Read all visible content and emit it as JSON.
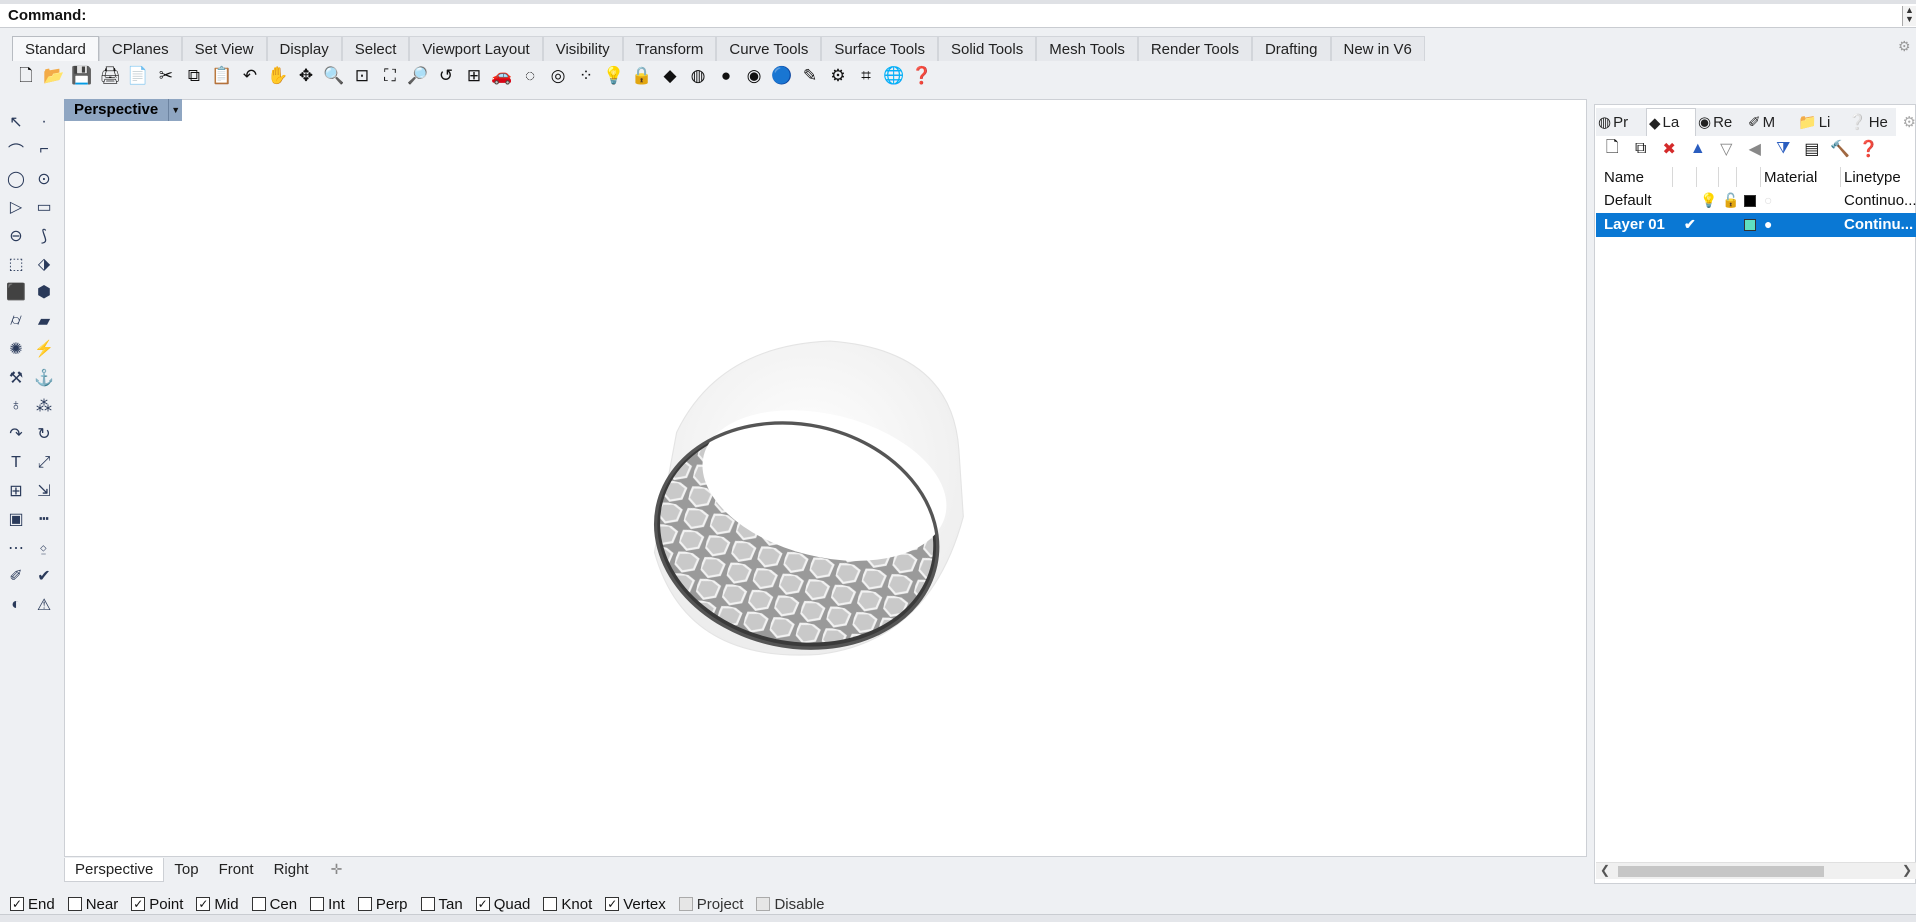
{
  "command": {
    "label": "Command:",
    "value": ""
  },
  "tabs": [
    {
      "label": "Standard",
      "active": true
    },
    {
      "label": "CPlanes"
    },
    {
      "label": "Set View"
    },
    {
      "label": "Display"
    },
    {
      "label": "Select"
    },
    {
      "label": "Viewport Layout"
    },
    {
      "label": "Visibility"
    },
    {
      "label": "Transform"
    },
    {
      "label": "Curve Tools"
    },
    {
      "label": "Surface Tools"
    },
    {
      "label": "Solid Tools"
    },
    {
      "label": "Mesh Tools"
    },
    {
      "label": "Render Tools"
    },
    {
      "label": "Drafting"
    },
    {
      "label": "New in V6"
    }
  ],
  "toolbar_icons": [
    "new-file-icon",
    "open-folder-icon",
    "save-icon",
    "print-icon",
    "import-icon",
    "cut-icon",
    "copy-icon",
    "paste-icon",
    "undo-icon",
    "pan-hand-icon",
    "rotate-view-icon",
    "zoom-icon",
    "zoom-window-icon",
    "zoom-extents-icon",
    "zoom-selected-icon",
    "undo-view-icon",
    "grid-viewports-icon",
    "car-icon",
    "hide-icon",
    "show-icon",
    "select-points-icon",
    "light-bulb-icon",
    "lock-icon",
    "layer-icon",
    "color-wheel-icon",
    "sphere-icon",
    "render-sphere-icon",
    "blue-sphere-icon",
    "highlight-icon",
    "gears-icon",
    "dimensions-icon",
    "globe-icon",
    "help-icon"
  ],
  "viewport": {
    "label": "Perspective",
    "tabs": [
      "Perspective",
      "Top",
      "Front",
      "Right"
    ],
    "active_tab": "Perspective"
  },
  "panel": {
    "tabs": [
      {
        "label": "Pr",
        "icon": "properties-icon"
      },
      {
        "label": "La",
        "icon": "layers-icon",
        "active": true
      },
      {
        "label": "Re",
        "icon": "rendering-icon"
      },
      {
        "label": "M",
        "icon": "materials-icon"
      },
      {
        "label": "Li",
        "icon": "libraries-icon"
      },
      {
        "label": "He",
        "icon": "help-panel-icon"
      }
    ],
    "columns": {
      "name": "Name",
      "material": "Material",
      "linetype": "Linetype"
    },
    "layers": [
      {
        "name": "Default",
        "linetype": "Continuo...",
        "color": "#000000",
        "selected": false
      },
      {
        "name": "Layer 01",
        "linetype": "Continu...",
        "color": "#5fe0c0",
        "selected": true
      }
    ]
  },
  "osnaps": [
    {
      "label": "End",
      "checked": true
    },
    {
      "label": "Near",
      "checked": false
    },
    {
      "label": "Point",
      "checked": true
    },
    {
      "label": "Mid",
      "checked": true
    },
    {
      "label": "Cen",
      "checked": false
    },
    {
      "label": "Int",
      "checked": false
    },
    {
      "label": "Perp",
      "checked": false
    },
    {
      "label": "Tan",
      "checked": false
    },
    {
      "label": "Quad",
      "checked": true
    },
    {
      "label": "Knot",
      "checked": false
    },
    {
      "label": "Vertex",
      "checked": true
    },
    {
      "label": "Project",
      "checked": false,
      "disabled": true
    },
    {
      "label": "Disable",
      "checked": false,
      "disabled": true
    }
  ],
  "colors": {
    "accent": "#0a78d4",
    "viewport_label": "#8fa6c2"
  }
}
